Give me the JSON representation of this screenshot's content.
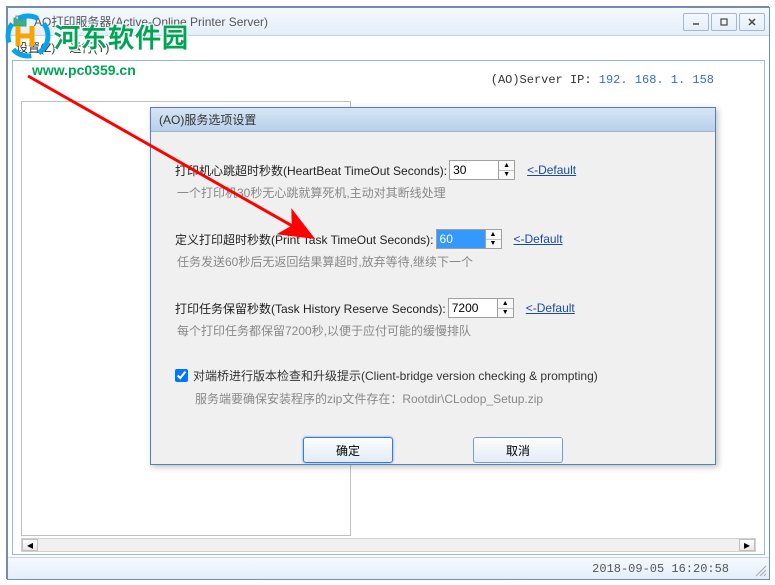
{
  "window": {
    "title": "AO打印服务器(Active-Online Printer Server)"
  },
  "menubar": {
    "item1": "设置(Z)",
    "item2": "运行(Y)"
  },
  "server_ip": {
    "label": "(AO)Server IP:",
    "value": "192. 168. 1. 158"
  },
  "statusbar": {
    "datetime": "2018-09-05 16:20:58"
  },
  "dialog": {
    "title": "(AO)服务选项设置",
    "heartbeat": {
      "label": "打印机心跳超时秒数(HeartBeat TimeOut Seconds):",
      "value": "30",
      "hint": "一个打印机30秒无心跳就算死机,主动对其断线处理"
    },
    "printtask": {
      "label": "定义打印超时秒数(Print Task TimeOut Seconds):",
      "value": "60",
      "hint": "任务发送60秒后无返回结果算超时,放弃等待,继续下一个"
    },
    "history": {
      "label": "打印任务保留秒数(Task History Reserve Seconds):",
      "value": "7200",
      "hint": "每个打印任务都保留7200秒,以便于应付可能的缓慢排队"
    },
    "default_link": "<-Default",
    "checkbox": {
      "label": "对端桥进行版本检查和升级提示(Client-bridge version checking & prompting)",
      "hint_prefix": "服务端要确保安装程序的zip文件存在：",
      "hint_path": "Rootdir\\CLodop_Setup.zip"
    },
    "buttons": {
      "ok": "确定",
      "cancel": "取消"
    }
  },
  "watermark": {
    "text": "河东软件园",
    "url": "www.pc0359.cn"
  }
}
